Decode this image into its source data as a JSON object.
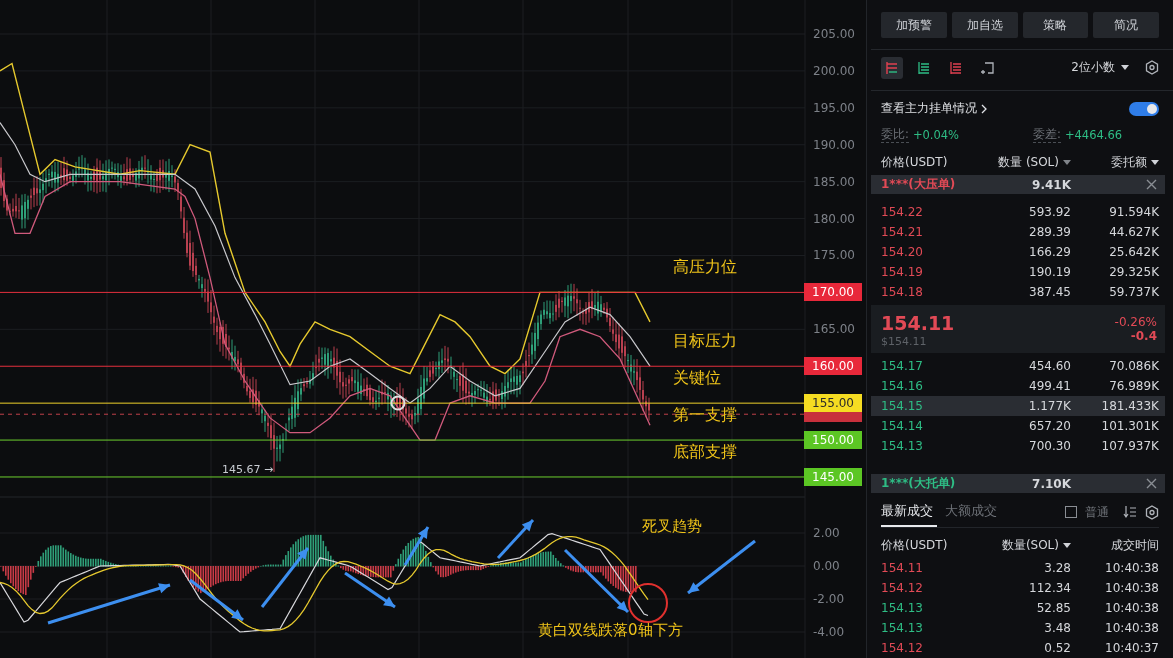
{
  "chart": {
    "price_ticks": [
      "205.00",
      "200.00",
      "195.00",
      "190.00",
      "185.00",
      "180.00",
      "175.00",
      "165.00"
    ],
    "levels": [
      {
        "tag": "170.00",
        "label": "高压力位",
        "kind": "resistance"
      },
      {
        "tag": "160.00",
        "label": "目标压力",
        "kind": "resistance"
      },
      {
        "tag": "155.00",
        "label": "关键位",
        "kind": "key"
      },
      {
        "tag": "150.00",
        "label": "第一支撑",
        "kind": "support"
      },
      {
        "tag": "145.00",
        "label": "底部支撑",
        "kind": "support"
      }
    ],
    "low_marker": "145.67 →",
    "macd_ticks": [
      "2.00",
      "0.00",
      "-2.00",
      "-4.00"
    ],
    "annotations": [
      {
        "text": "死叉趋势",
        "kind": "top"
      },
      {
        "text": "黄白双线跌落0轴下方",
        "kind": "bottom"
      }
    ]
  },
  "panel": {
    "actions": [
      "加预警",
      "加自选",
      "策略",
      "简况"
    ],
    "views": [
      {
        "kind": "both",
        "selected": true
      },
      {
        "kind": "bids",
        "selected": false
      },
      {
        "kind": "asks",
        "selected": false
      },
      {
        "kind": "custom",
        "selected": false
      }
    ],
    "precision": "2位小数",
    "main_orders": {
      "label": "查看主力挂单情况",
      "on": true
    },
    "ratio_label": "委比:",
    "ratio": "+0.04%",
    "diff_label": "委差:",
    "diff": "+4464.66",
    "book_columns": [
      "价格(USDT)",
      "数量 (SOL)",
      "委托额"
    ],
    "ask_banner": {
      "label": "1***(大压单)",
      "amount": "9.41K"
    },
    "asks": [
      {
        "price": "154.22",
        "qty": "593.92",
        "total": "91.594K"
      },
      {
        "price": "154.21",
        "qty": "289.39",
        "total": "44.627K"
      },
      {
        "price": "154.20",
        "qty": "166.29",
        "total": "25.642K"
      },
      {
        "price": "154.19",
        "qty": "190.19",
        "total": "29.325K"
      },
      {
        "price": "154.18",
        "qty": "387.45",
        "total": "59.737K"
      }
    ],
    "last": {
      "price": "154.11",
      "usd": "$154.11",
      "change_pct": "-0.26%",
      "change": "-0.4"
    },
    "bids": [
      {
        "price": "154.17",
        "qty": "454.60",
        "total": "70.086K",
        "selected": false
      },
      {
        "price": "154.16",
        "qty": "499.41",
        "total": "76.989K",
        "selected": false
      },
      {
        "price": "154.15",
        "qty": "1.177K",
        "total": "181.433K",
        "selected": true
      },
      {
        "price": "154.14",
        "qty": "657.20",
        "total": "101.301K",
        "selected": false
      },
      {
        "price": "154.13",
        "qty": "700.30",
        "total": "107.937K",
        "selected": false
      }
    ],
    "bid_banner": {
      "label": "1***(大托单)",
      "amount": "7.10K"
    },
    "trade_tabs": [
      {
        "label": "最新成交",
        "selected": true
      },
      {
        "label": "大额成交",
        "selected": false
      }
    ],
    "plain_filter": {
      "label": "普通",
      "checked": false
    },
    "trade_columns": [
      "价格(USDT)",
      "数量(SOL)",
      "成交时间"
    ],
    "trades": [
      {
        "price": "154.11",
        "qty": "3.28",
        "time": "10:40:38",
        "color": "#e24a56"
      },
      {
        "price": "154.12",
        "qty": "112.34",
        "time": "10:40:38",
        "color": "#e24a56"
      },
      {
        "price": "154.13",
        "qty": "52.85",
        "time": "10:40:38",
        "color": "#2ebd85"
      },
      {
        "price": "154.13",
        "qty": "3.48",
        "time": "10:40:38",
        "color": "#2ebd85"
      },
      {
        "price": "154.12",
        "qty": "0.52",
        "time": "10:40:37",
        "color": "#e24a56"
      }
    ]
  }
}
